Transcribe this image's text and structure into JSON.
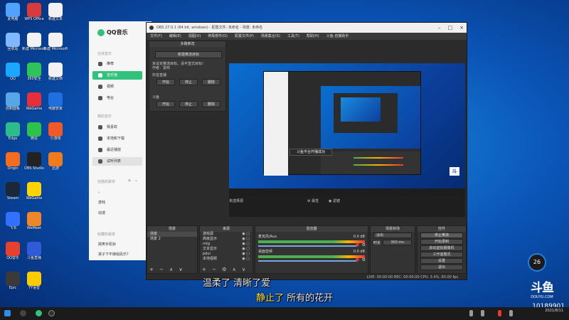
{
  "desktop_icons": [
    {
      "label": "此电脑",
      "color": "#4fa3ff",
      "col": 0,
      "row": 0
    },
    {
      "label": "WPS Office",
      "color": "#d83b3b",
      "col": 1,
      "row": 0
    },
    {
      "label": "新建文本",
      "color": "#f2f2f2",
      "col": 2,
      "row": 0
    },
    {
      "label": "回收站",
      "color": "#7fb8ff",
      "col": 0,
      "row": 1
    },
    {
      "label": "新建 Microsoft",
      "color": "#f2f2f2",
      "col": 1,
      "row": 1
    },
    {
      "label": "新建 Microsoft",
      "color": "#f2f2f2",
      "col": 2,
      "row": 1
    },
    {
      "label": "QQ",
      "color": "#1aa8ff",
      "col": 0,
      "row": 2
    },
    {
      "label": "360安全",
      "color": "#2ec45a",
      "col": 1,
      "row": 2
    },
    {
      "label": "新建文档",
      "color": "#f2f2f2",
      "col": 2,
      "row": 2
    },
    {
      "label": "控制面板",
      "color": "#57a6e8",
      "col": 0,
      "row": 3
    },
    {
      "label": "WeGame",
      "color": "#e5303a",
      "col": 1,
      "row": 3
    },
    {
      "label": "电脑管家",
      "color": "#1f6fe0",
      "col": 2,
      "row": 3
    },
    {
      "label": "Edge",
      "color": "#2dbd8c",
      "col": 0,
      "row": 4
    },
    {
      "label": "微信",
      "color": "#2cc24b",
      "col": 1,
      "row": 4
    },
    {
      "label": "小游戏",
      "color": "#f05a28",
      "col": 2,
      "row": 4
    },
    {
      "label": "Origin",
      "color": "#f56c1e",
      "col": 0,
      "row": 5
    },
    {
      "label": "OBS Studio",
      "color": "#222222",
      "col": 1,
      "row": 5
    },
    {
      "label": "迅游",
      "color": "#f07a1e",
      "col": 2,
      "row": 5
    },
    {
      "label": "Steam",
      "color": "#1b2838",
      "col": 0,
      "row": 6
    },
    {
      "label": "WeGame",
      "color": "#ffd400",
      "col": 1,
      "row": 6
    },
    {
      "label": "飞书",
      "color": "#3370ff",
      "col": 0,
      "row": 7
    },
    {
      "label": "WeMeet",
      "color": "#f0862a",
      "col": 1,
      "row": 7
    },
    {
      "label": "QQ音乐",
      "color": "#e8402e",
      "col": 0,
      "row": 8
    },
    {
      "label": "斗鱼直播",
      "color": "#2f5bd8",
      "col": 1,
      "row": 8
    },
    {
      "label": "Epic",
      "color": "#3a3a3a",
      "col": 0,
      "row": 9
    },
    {
      "label": "YY语音",
      "color": "#ffcc00",
      "col": 1,
      "row": 9
    }
  ],
  "qq_music": {
    "brand": "QQ音乐",
    "section_online": "在线音乐",
    "section_mine": "我的音乐",
    "section_created": "创建的歌单",
    "section_collected": "收藏的歌单",
    "online_items": [
      {
        "label": "推荐",
        "active": false
      },
      {
        "label": "音乐馆",
        "active": true
      },
      {
        "label": "视频",
        "active": false
      },
      {
        "label": "电台",
        "active": false
      }
    ],
    "mine_items": [
      {
        "label": "我喜欢",
        "selected": false
      },
      {
        "label": "本地和下载",
        "selected": false
      },
      {
        "label": "最近播放",
        "selected": false
      },
      {
        "label": "试听列表",
        "selected": true
      }
    ],
    "created_items": [
      "。",
      "游戏",
      "动漫"
    ],
    "collected_items": [
      "搞笑手机铃",
      "孩子下不嫁给民乐?"
    ],
    "created_add": "+",
    "created_toggle": "⌄"
  },
  "obs": {
    "title": "OBS 27.0.1 (64 bit, windows) - 配置文件: 未命名 - 场景: 未命名",
    "menu": [
      "文件(F)",
      "编辑(E)",
      "视图(V)",
      "停靠部件(D)",
      "配置文件(P)",
      "场景集合(S)",
      "工具(T)",
      "帮助(H)",
      "斗鱼-自播助手"
    ],
    "dock": {
      "title": "多路推流",
      "new_button": "新建推流目标",
      "hint_line1": "未设定推流目标，请平直式目标！",
      "hint_line2": "作者：雷鸣",
      "target_a": "抖音直播",
      "target_b": "斗鱼",
      "btn_start": "开始",
      "btn_stop": "停止",
      "btn_delete": "删除"
    },
    "toast": "斗鱼平台开播成功",
    "no_source": "未选择源",
    "toolbar": {
      "props": "⚙ 属性",
      "filters": "◉ 滤镜"
    },
    "panels": {
      "scenes": {
        "title": "场景",
        "items": [
          "场景",
          "场景 2"
        ]
      },
      "sources": {
        "title": "来源",
        "items": [
          "游戏源",
          "高级显示",
          "mtg",
          "文本显示",
          "pdui",
          "本地视频"
        ]
      },
      "mixer": {
        "title": "混音器",
        "tracks": [
          {
            "name": "麦克风/Aux",
            "db": "0.0 dB"
          },
          {
            "name": "桌面音频",
            "db": "0.0 dB"
          }
        ]
      },
      "transitions": {
        "title": "场景转场",
        "type": "淡出",
        "duration_label": "时长",
        "duration": "300 ms"
      },
      "controls": {
        "title": "控件",
        "buttons": [
          "停止推流",
          "开始录制",
          "启动虚拟摄像机",
          "工作室模式",
          "设置",
          "退出"
        ]
      }
    },
    "status": "LIVE: 00:00:00   REC: 00:00:00   CPU: 3.4%, 60.00 fps"
  },
  "subtitles": {
    "line1": "温柔了 清晰了爱",
    "line2_sung": "静止了",
    "line2_rest": " 所有的花开"
  },
  "douyu": {
    "logo": "斗鱼",
    "domain": "DOUYU.COM",
    "room_id": "10189901"
  },
  "net_speed": "26",
  "taskbar": {
    "time": "",
    "date": "2021/8/11"
  }
}
